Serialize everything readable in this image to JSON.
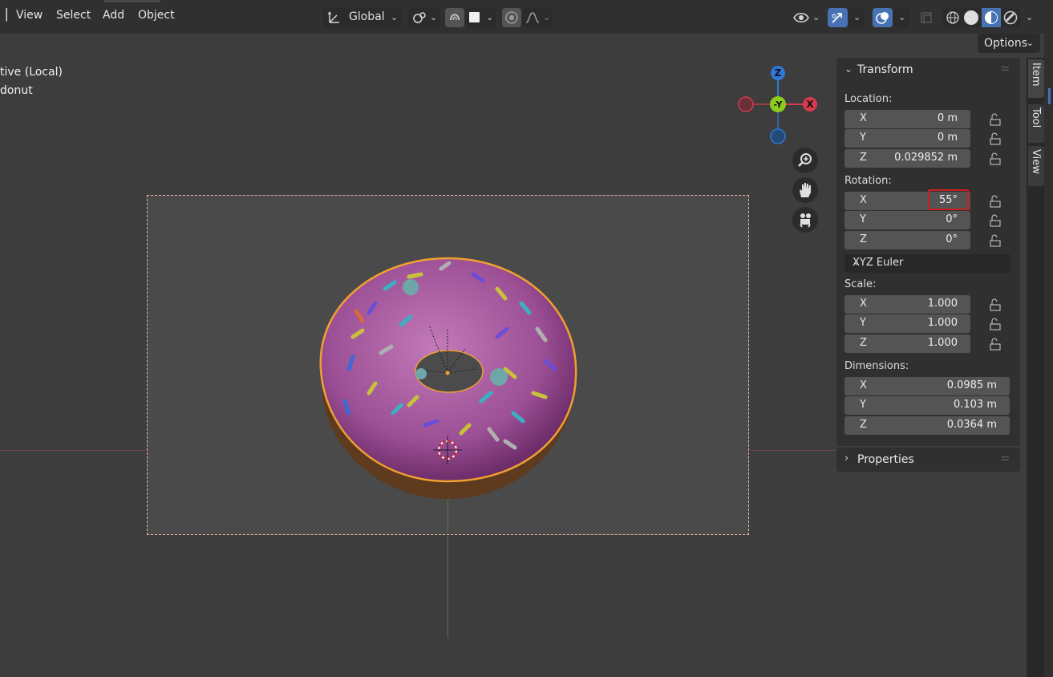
{
  "menu": {
    "view": "View",
    "select": "Select",
    "add": "Add",
    "object": "Object"
  },
  "header": {
    "transform_orientation": "Global",
    "options_label": "Options",
    "icons": [
      "transform-axes-icon",
      "pivot-link-icon",
      "snap-magnet-icon",
      "snap-target-icon",
      "proportional-edit-icon",
      "falloff-curve-icon",
      "visibility-eye-icon",
      "gizmo-arrow-icon",
      "overlay-circles-icon",
      "xray-icon",
      "wireframe-shading-icon",
      "solid-shading-icon",
      "material-shading-icon",
      "rendered-shading-icon"
    ]
  },
  "viewport": {
    "overlay_line1": "tive (Local)",
    "overlay_line2": "donut",
    "axes": {
      "z": "Z",
      "y": "-Y",
      "x": "X"
    }
  },
  "transform_panel": {
    "title": "Transform",
    "location_label": "Location:",
    "location": [
      {
        "axis": "X",
        "value": "0 m"
      },
      {
        "axis": "Y",
        "value": "0 m"
      },
      {
        "axis": "Z",
        "value": "0.029852 m"
      }
    ],
    "rotation_label": "Rotation:",
    "rotation": [
      {
        "axis": "X",
        "value": "55°"
      },
      {
        "axis": "Y",
        "value": "0°"
      },
      {
        "axis": "Z",
        "value": "0°"
      }
    ],
    "rotation_mode": "XYZ Euler",
    "scale_label": "Scale:",
    "scale": [
      {
        "axis": "X",
        "value": "1.000"
      },
      {
        "axis": "Y",
        "value": "1.000"
      },
      {
        "axis": "Z",
        "value": "1.000"
      }
    ],
    "dimensions_label": "Dimensions:",
    "dimensions": [
      {
        "axis": "X",
        "value": "0.0985 m"
      },
      {
        "axis": "Y",
        "value": "0.103 m"
      },
      {
        "axis": "Z",
        "value": "0.0364 m"
      }
    ]
  },
  "properties_panel": {
    "title": "Properties"
  },
  "sidebar_tabs": [
    "Item",
    "Tool",
    "View"
  ],
  "colors": {
    "x_axis": "#d63b4b",
    "y_axis": "#8ccc1f",
    "z_axis": "#2f77d8",
    "selection": "#f0a030",
    "highlight": "#cc1f1f",
    "accent": "#4772b3"
  }
}
